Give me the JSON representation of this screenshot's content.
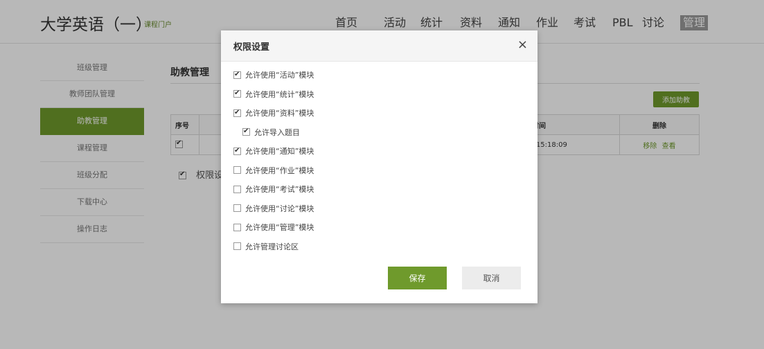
{
  "header": {
    "course_title": "大学英语（一）",
    "portal_link": "课程门户",
    "nav": [
      "首页",
      "活动",
      "统计",
      "资料",
      "通知",
      "作业",
      "考试",
      "PBL",
      "讨论",
      "管理"
    ],
    "active_nav": "管理"
  },
  "sidebar": {
    "items": [
      "班级管理",
      "教师团队管理",
      "助教管理",
      "课程管理",
      "班级分配",
      "下载中心",
      "操作日志"
    ],
    "active_item": "助教管理"
  },
  "main": {
    "section_title": "助教管理",
    "add_button": "添加助教",
    "table": {
      "headers": [
        "序号",
        "",
        "入时间",
        "删除"
      ],
      "rows": [
        {
          "checked": true,
          "time": "29 15:18:09",
          "remove": "移除",
          "view": "查看"
        }
      ]
    },
    "permission_label": "权限设"
  },
  "dialog": {
    "title": "权限设置",
    "close": "×",
    "options": [
      {
        "label": "允许使用“活动”模块",
        "checked": true,
        "indent": false
      },
      {
        "label": "允许使用“统计”模块",
        "checked": true,
        "indent": false
      },
      {
        "label": "允许使用“资料”模块",
        "checked": true,
        "indent": false
      },
      {
        "label": "允许导入题目",
        "checked": true,
        "indent": true
      },
      {
        "label": "允许使用“通知”模块",
        "checked": true,
        "indent": false
      },
      {
        "label": "允许使用“作业”模块",
        "checked": false,
        "indent": false
      },
      {
        "label": "允许使用“考试”模块",
        "checked": false,
        "indent": false
      },
      {
        "label": "允许使用“讨论”模块",
        "checked": false,
        "indent": false
      },
      {
        "label": "允许使用“管理”模块",
        "checked": false,
        "indent": false
      },
      {
        "label": "允许管理讨论区",
        "checked": false,
        "indent": false
      }
    ],
    "save": "保存",
    "cancel": "取消"
  },
  "colors": {
    "accent": "#6f9a2c",
    "overlay": "rgba(0,0,0,0.28)"
  }
}
